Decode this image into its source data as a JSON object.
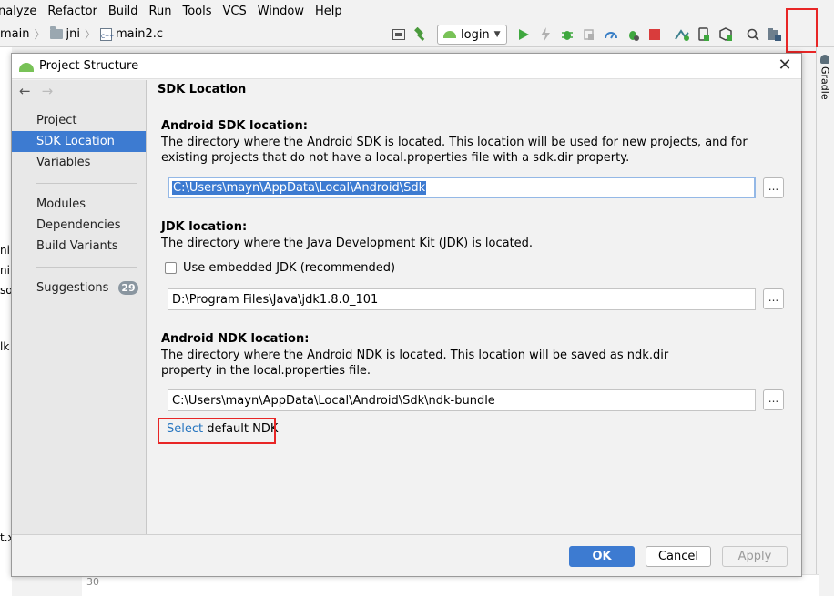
{
  "menu": [
    "nalyze",
    "Refactor",
    "Build",
    "Run",
    "Tools",
    "VCS",
    "Window",
    "Help"
  ],
  "breadcrumb": {
    "items": [
      "main",
      "jni",
      "main2.c"
    ],
    "cfile_badge": "C++"
  },
  "toolbar": {
    "run_config": "login",
    "icons": [
      "layout-icon",
      "hammer-icon",
      "run-icon",
      "apply-changes-icon",
      "debug-icon",
      "attach-icon",
      "profile-icon",
      "coverage-icon",
      "stop-icon",
      "sync-icon",
      "avd-icon",
      "sdk-icon",
      "search-icon",
      "project-structure-icon"
    ]
  },
  "right_panel": {
    "tab": "Gradle"
  },
  "left_edge_fragments": [
    "ni",
    "ni.",
    "so",
    "lk",
    "t.x"
  ],
  "editor": {
    "line_number": "30"
  },
  "dialog": {
    "title": "Project Structure",
    "sidebar": {
      "items": [
        "Project",
        "SDK Location",
        "Variables",
        "Modules",
        "Dependencies",
        "Build Variants",
        "Suggestions"
      ],
      "selected": "SDK Location",
      "suggestions_count": "29"
    },
    "content": {
      "title": "SDK Location",
      "android_sdk": {
        "heading": "Android SDK location:",
        "desc": "The directory where the Android SDK is located. This location will be used for new projects, and for existing projects that do not have a local.properties file with a sdk.dir property.",
        "value": "C:\\Users\\mayn\\AppData\\Local\\Android\\Sdk"
      },
      "jdk": {
        "heading": "JDK location:",
        "desc": "The directory where the Java Development Kit (JDK) is located.",
        "checkbox_label": "Use embedded JDK (recommended)",
        "checked": false,
        "value": "D:\\Program Files\\Java\\jdk1.8.0_101"
      },
      "ndk": {
        "heading": "Android NDK location:",
        "desc": "The directory where the Android NDK is located. This location will be saved as ndk.dir property in the local.properties file.",
        "value": "C:\\Users\\mayn\\AppData\\Local\\Android\\Sdk\\ndk-bundle",
        "select_link": "Select",
        "select_rest": " default NDK"
      },
      "browse_label": "..."
    },
    "buttons": {
      "ok": "OK",
      "cancel": "Cancel",
      "apply": "Apply"
    }
  },
  "colors": {
    "accent": "#3d7bd1",
    "highlight": "#e82626",
    "link": "#2675bf"
  }
}
